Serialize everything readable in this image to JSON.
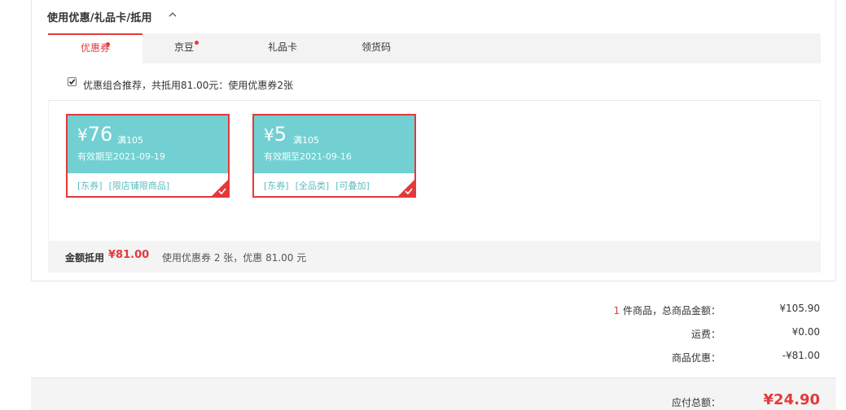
{
  "section": {
    "title": "使用优惠/礼品卡/抵用"
  },
  "tabs": [
    {
      "label": "优惠券",
      "active": true,
      "dot": true
    },
    {
      "label": "京豆",
      "active": false,
      "dot": true
    },
    {
      "label": "礼品卡",
      "active": false,
      "dot": false
    },
    {
      "label": "领货码",
      "active": false,
      "dot": false
    }
  ],
  "recommend": {
    "checked": true,
    "text": "优惠组合推荐，共抵用81.00元：使用优惠券2张"
  },
  "coupons": [
    {
      "amount": "76",
      "currency": "¥",
      "condition": "满105",
      "expire": "有效期至2021-09-19",
      "tags": [
        "[东券]",
        "[限店铺限商品]"
      ],
      "selected": true
    },
    {
      "amount": "5",
      "currency": "¥",
      "condition": "满105",
      "expire": "有效期至2021-09-16",
      "tags": [
        "[东券]",
        "[全品类]",
        "[可叠加]"
      ],
      "selected": true
    }
  ],
  "summary": {
    "label": "金额抵用",
    "amount": "¥81.00",
    "text": "使用优惠券 2 张，优惠 81.00 元"
  },
  "totals": {
    "count": "1",
    "items_label": "件商品，总商品金额：",
    "items_value": "¥105.90",
    "shipping_label": "运费：",
    "shipping_value": "¥0.00",
    "discount_label": "商品优惠：",
    "discount_value": "-¥81.00"
  },
  "pay": {
    "label": "应付总额：",
    "value": "¥24.90"
  },
  "colors": {
    "accent": "#e4393c",
    "coupon": "#72d0d2",
    "coupon_tag": "#5dbdc0"
  }
}
